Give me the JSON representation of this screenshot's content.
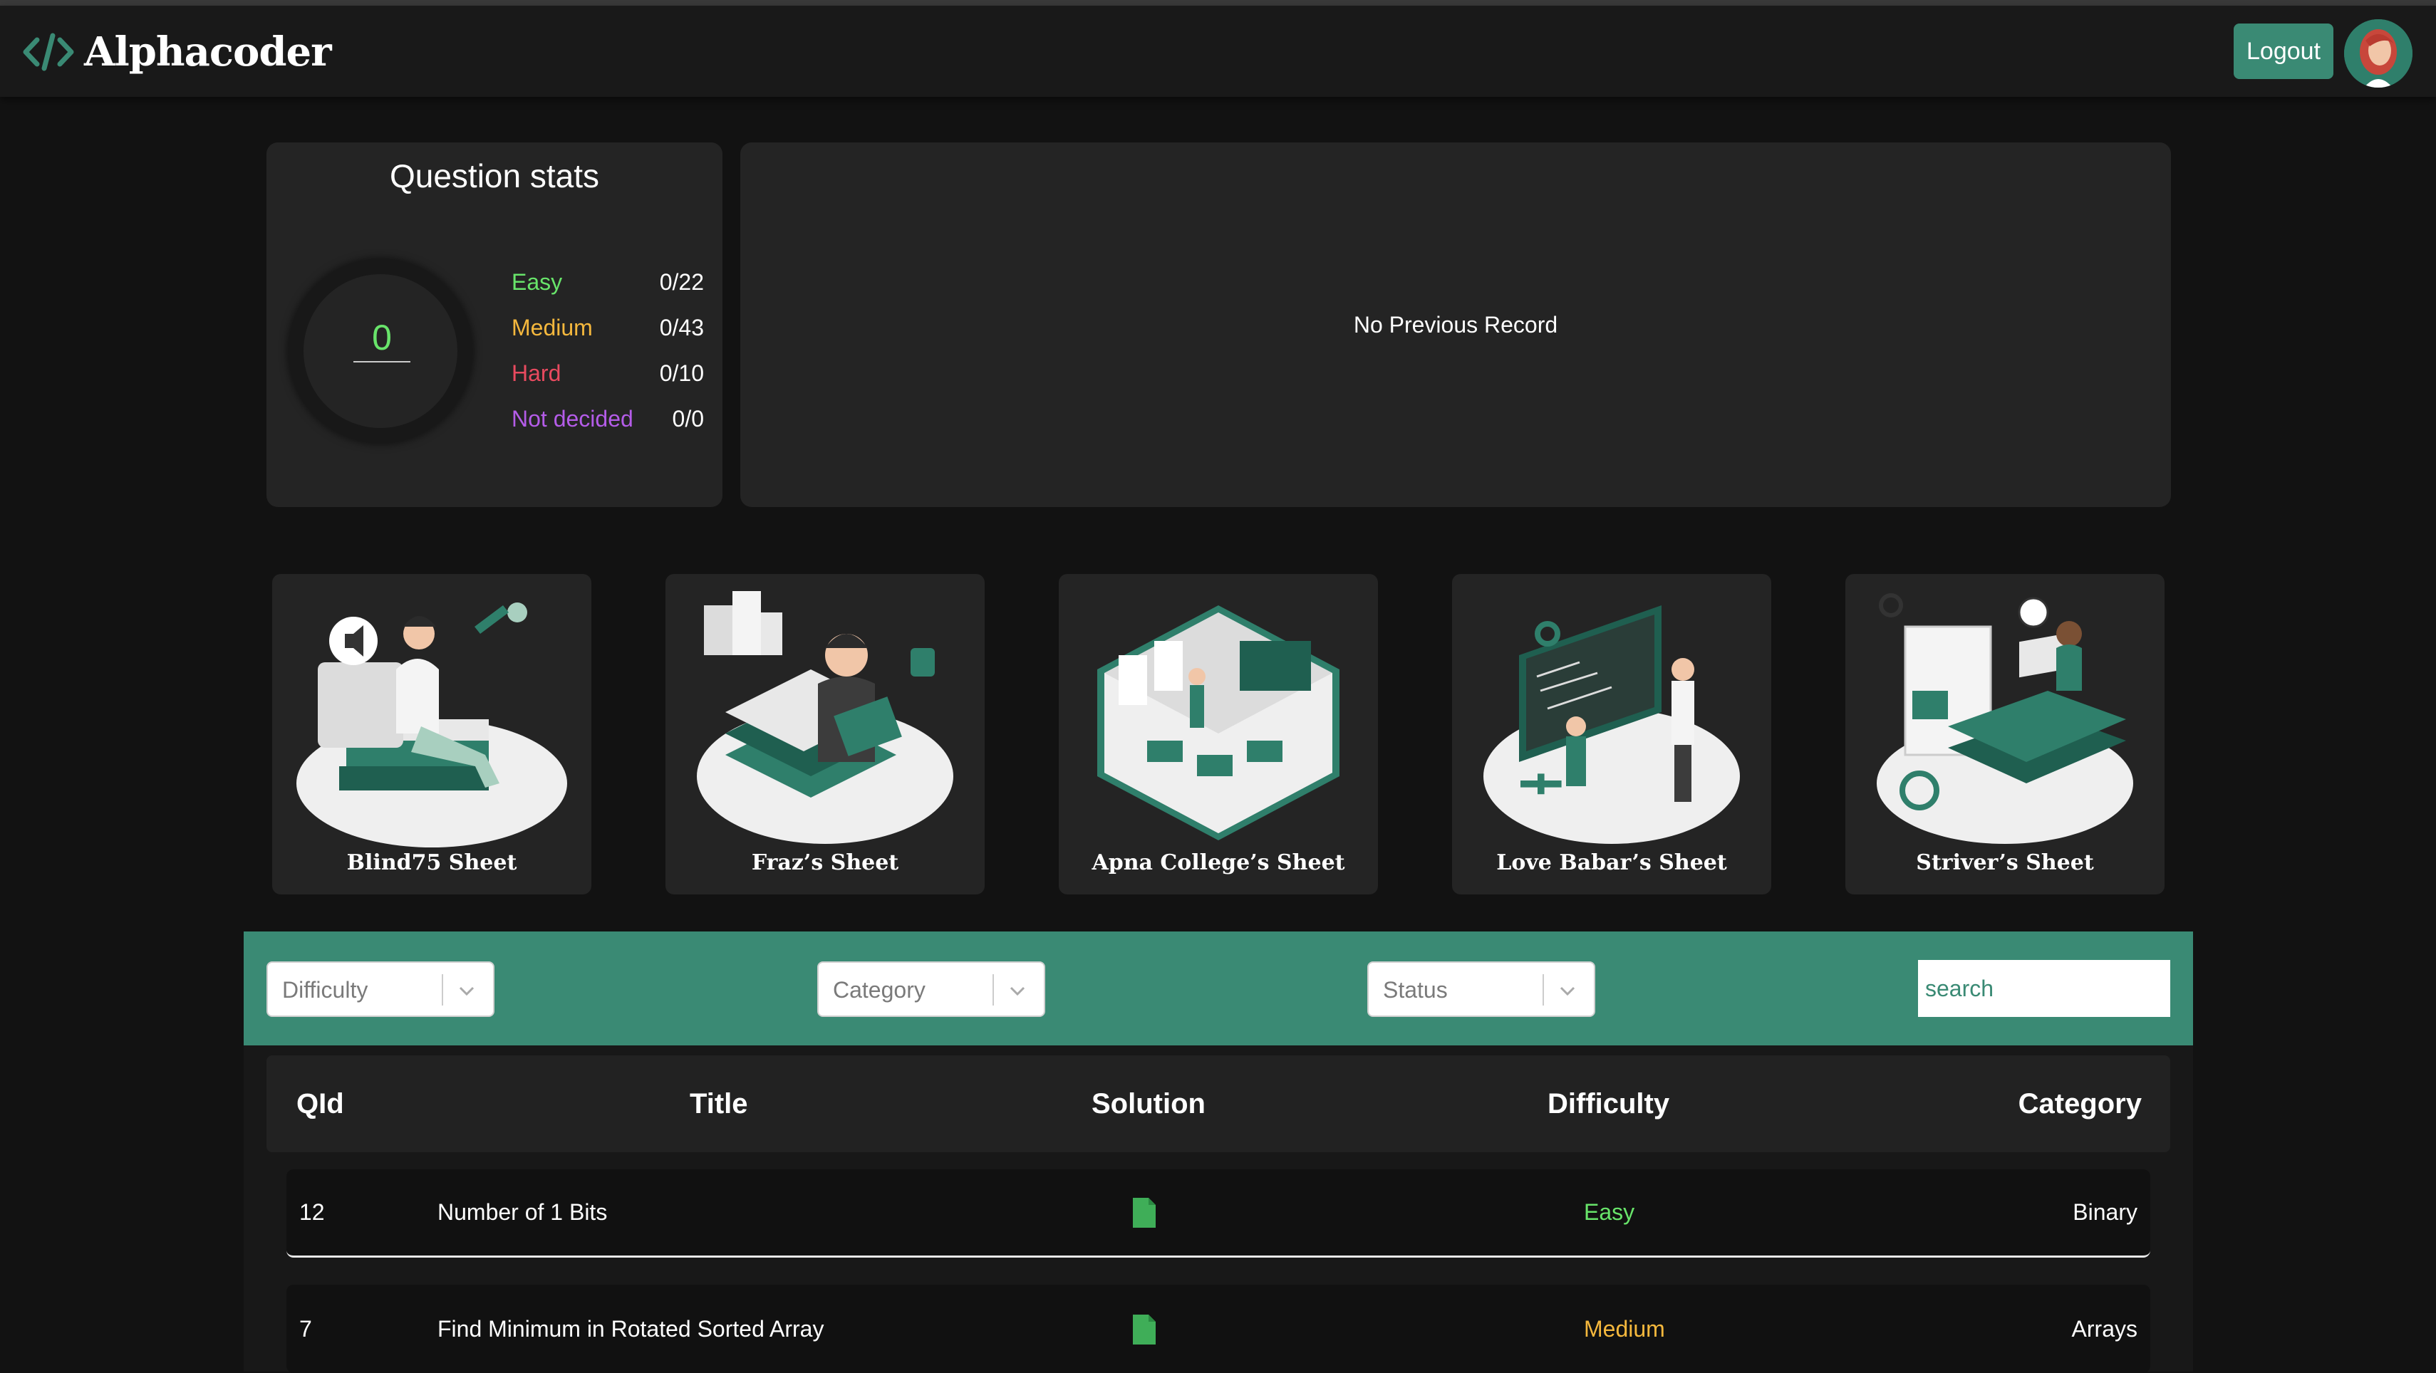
{
  "header": {
    "brand": "Alphacoder",
    "logout_label": "Logout"
  },
  "stats": {
    "title": "Question stats",
    "solved": "0",
    "rows": [
      {
        "label": "Easy",
        "value": "0/22",
        "color": "#68e46a"
      },
      {
        "label": "Medium",
        "value": "0/43",
        "color": "#f5b83d"
      },
      {
        "label": "Hard",
        "value": "0/10",
        "color": "#e84a5f"
      },
      {
        "label": "Not decided",
        "value": "0/0",
        "color": "#b45ce8"
      }
    ]
  },
  "history": {
    "message": "No Previous Record"
  },
  "sheets": [
    {
      "name": "Blind75 Sheet"
    },
    {
      "name": "Fraz’s Sheet"
    },
    {
      "name": "Apna College’s Sheet"
    },
    {
      "name": "Love Babar’s Sheet"
    },
    {
      "name": "Striver’s Sheet"
    }
  ],
  "filters": {
    "difficulty": "Difficulty",
    "category": "Category",
    "status": "Status",
    "search_placeholder": "search"
  },
  "table": {
    "headers": {
      "qid": "QId",
      "title": "Title",
      "solution": "Solution",
      "difficulty": "Difficulty",
      "category": "Category"
    },
    "rows": [
      {
        "qid": "12",
        "title": "Number of 1 Bits",
        "difficulty": "Easy",
        "difficulty_color": "#68e46a",
        "category": "Binary"
      },
      {
        "qid": "7",
        "title": "Find Minimum in Rotated Sorted Array",
        "difficulty": "Medium",
        "difficulty_color": "#f5b83d",
        "category": "Arrays"
      }
    ]
  },
  "colors": {
    "accent": "#3a8a74",
    "background": "#121212",
    "card": "#242424"
  }
}
